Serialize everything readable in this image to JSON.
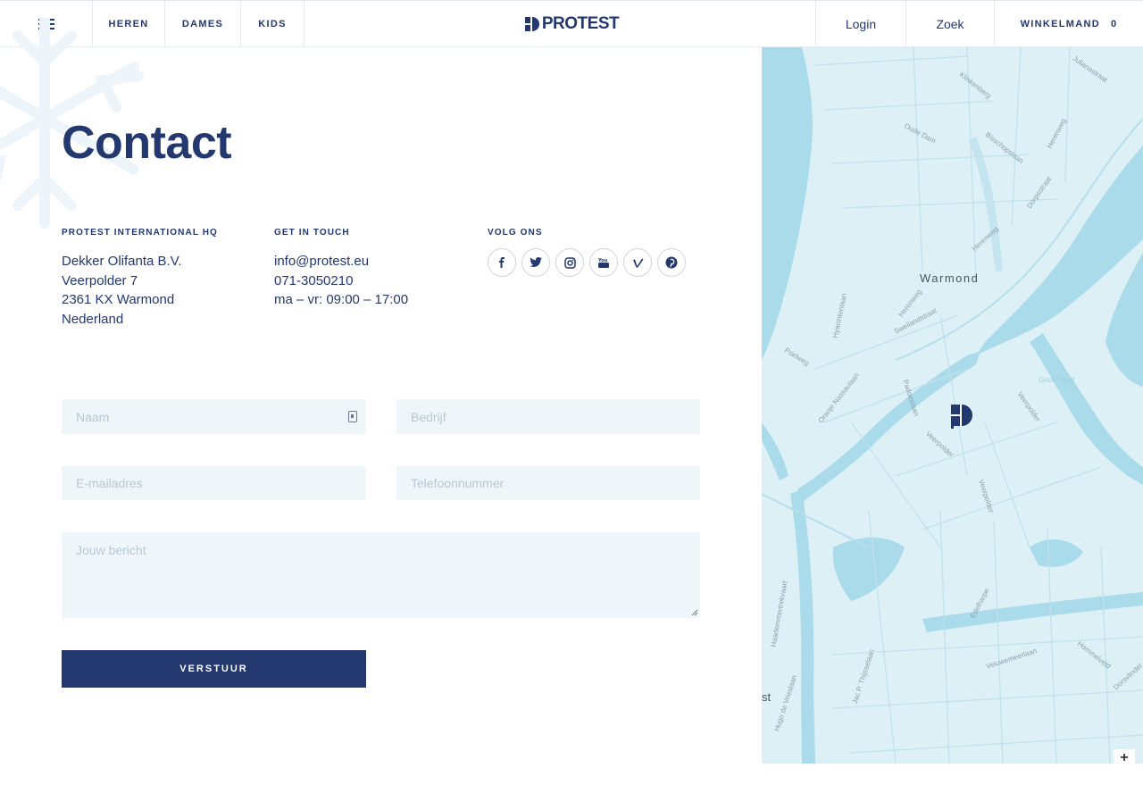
{
  "header": {
    "nav": [
      "Heren",
      "Dames",
      "Kids"
    ],
    "logo_text": "PROTEST",
    "login_label": "Login",
    "search_label": "Zoek",
    "cart_label": "Winkelmand",
    "cart_count": "0"
  },
  "page": {
    "title": "Contact"
  },
  "columns": {
    "hq": {
      "title": "Protest International HQ",
      "lines": [
        "Dekker Olifanta B.V.",
        "Veerpolder 7",
        "2361 KX Warmond",
        "Nederland"
      ]
    },
    "contact": {
      "title": "Get in touch",
      "email": "info@protest.eu",
      "phone": "071-3050210",
      "hours": "ma – vr: 09:00 – 17:00"
    },
    "social": {
      "title": "Volg ons",
      "icons": [
        "facebook-icon",
        "twitter-icon",
        "instagram-icon",
        "youtube-icon",
        "vimeo-icon",
        "pinterest-icon"
      ]
    }
  },
  "form": {
    "name_placeholder": "Naam",
    "company_placeholder": "Bedrijf",
    "email_placeholder": "E-mailadres",
    "phone_placeholder": "Telefoonnummer",
    "message_placeholder": "Jouw bericht",
    "submit_label": "Verstuur"
  },
  "map": {
    "place": "Warmond",
    "streets": [
      "Klinkenberg",
      "Julianastraat",
      "Oude Dam",
      "Bisschopslaan",
      "Herenweg",
      "Dorpsstraat",
      "Herenweg",
      "Hyacintenlaan",
      "Herenweg",
      "Sweilandstraat",
      "Poelweg",
      "Oranje Nassaulaan",
      "Padoeslaan",
      "Veerpolder",
      "Veerpolder",
      "Veerpolder",
      "Grote Sloot",
      "Haarlemmertrekvaart",
      "Hugo de Vrieslaan",
      "Jac P. Thijsselaan",
      "Veluwemeerlaan",
      "Hommelveld",
      "Edelharpe",
      "Dorsvlinder"
    ],
    "fragment_label": "st",
    "zoom_label": "+"
  },
  "colors": {
    "brand": "#22386e",
    "field_bg": "#eff6fa",
    "map_land": "#ddf0f6",
    "map_water": "#a9dbea"
  }
}
